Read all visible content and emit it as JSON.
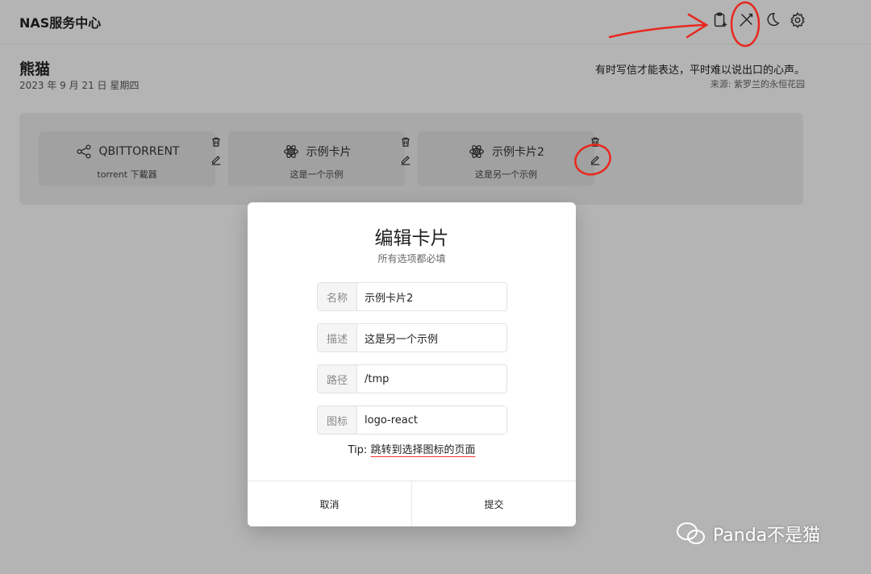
{
  "app": {
    "title": "NAS服务中心"
  },
  "toolbar": {
    "icons": [
      "clipboard-add-icon",
      "edit-mode-icon",
      "moon-icon",
      "gear-icon"
    ]
  },
  "greeting": {
    "name": "熊猫",
    "date": "2023 年 9 月 21 日 星期四"
  },
  "quote": {
    "text": "有时写信才能表达，平时难以说出口的心声。",
    "source": "来源: 紫罗兰的永恒花园"
  },
  "cards": [
    {
      "title": "QBITTORRENT",
      "desc": "torrent 下載器",
      "icon": "share-icon"
    },
    {
      "title": "示例卡片",
      "desc": "这是一个示例",
      "icon": "react-logo-icon"
    },
    {
      "title": "示例卡片2",
      "desc": "这是另一个示例",
      "icon": "react-logo-icon"
    }
  ],
  "modal": {
    "title": "编辑卡片",
    "subtitle": "所有选项都必填",
    "fields": [
      {
        "label": "名称",
        "value": "示例卡片2"
      },
      {
        "label": "描述",
        "value": "这是另一个示例"
      },
      {
        "label": "路径",
        "value": "/tmp"
      },
      {
        "label": "图标",
        "value": "logo-react"
      }
    ],
    "tip_prefix": "Tip: ",
    "tip_link": "跳转到选择图标的页面",
    "cancel": "取消",
    "submit": "提交"
  },
  "watermark": {
    "text": "Panda不是猫"
  },
  "colors": {
    "annotation": "#e8281e",
    "background": "#fafafa",
    "card": "#e0e0e0"
  }
}
